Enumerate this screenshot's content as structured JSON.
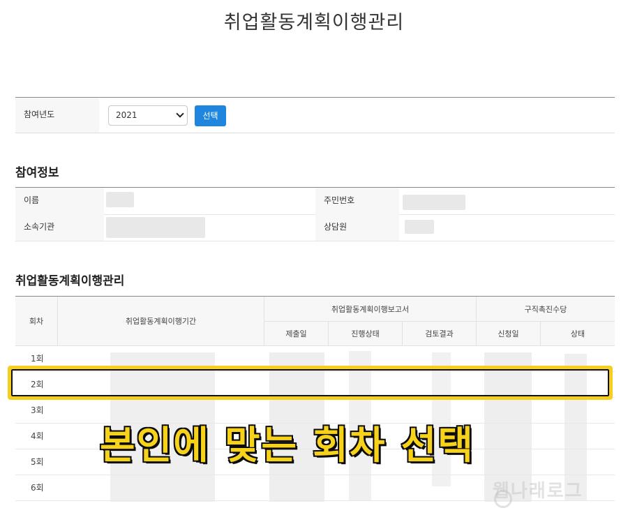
{
  "page_title": "취업활동계획이행관리",
  "year_select": {
    "label": "참여년도",
    "value": "2021",
    "button": "선택"
  },
  "participant_info": {
    "heading": "참여정보",
    "name_label": "이름",
    "rrn_label": "주민번호",
    "agency_label": "소속기관",
    "counselor_label": "상담원"
  },
  "management": {
    "heading": "취업활동계획이행관리",
    "headers": {
      "round": "회차",
      "period": "취업활동계획이행기간",
      "report_group": "취업활동계획이행보고서",
      "submit_date": "제출일",
      "progress": "진행상태",
      "review": "검토결과",
      "allowance_group": "구직촉진수당",
      "apply_date": "신청일",
      "status": "상태"
    },
    "rows": [
      "1회",
      "2회",
      "3회",
      "4회",
      "5회",
      "6회"
    ]
  },
  "overlay_caption": "본인에 맞는 회차 선택",
  "watermark": "웹나래로그"
}
